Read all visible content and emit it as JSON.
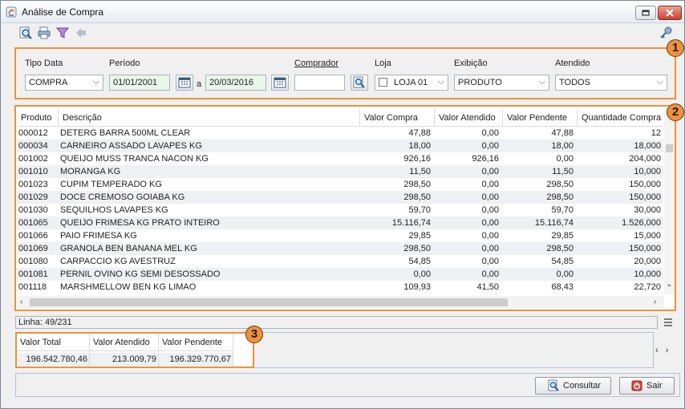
{
  "window": {
    "title": "Análise de Compra"
  },
  "filters": {
    "tipo_data": {
      "label": "Tipo Data",
      "value": "COMPRA"
    },
    "periodo": {
      "label": "Período",
      "start": "01/01/2001",
      "separator": "a",
      "end": "20/03/2016"
    },
    "comprador": {
      "label": "Comprador",
      "value": ""
    },
    "loja": {
      "label": "Loja",
      "value": "LOJA 01"
    },
    "exibicao": {
      "label": "Exibição",
      "value": "PRODUTO"
    },
    "atendido": {
      "label": "Atendido",
      "value": "TODOS"
    }
  },
  "badges": {
    "one": "1",
    "two": "2",
    "three": "3"
  },
  "table": {
    "headers": [
      "Produto",
      "Descrição",
      "Valor Compra",
      "Valor Atendido",
      "Valor Pendente",
      "Quantidade Compra"
    ],
    "rows": [
      [
        "000012",
        "DETERG BARRA 500ML CLEAR",
        "47,88",
        "0,00",
        "47,88",
        "12"
      ],
      [
        "000034",
        "CARNEIRO ASSADO LAVAPES KG",
        "18,00",
        "0,00",
        "18,00",
        "18,000"
      ],
      [
        "001002",
        "QUEIJO MUSS TRANCA NACON KG",
        "926,16",
        "926,16",
        "0,00",
        "204,000"
      ],
      [
        "001010",
        "MORANGA KG",
        "11,50",
        "0,00",
        "11,50",
        "10,000"
      ],
      [
        "001023",
        "CUPIM TEMPERADO KG",
        "298,50",
        "0,00",
        "298,50",
        "150,000"
      ],
      [
        "001029",
        "DOCE CREMOSO GOIABA KG",
        "298,50",
        "0,00",
        "298,50",
        "150,000"
      ],
      [
        "001030",
        "SEQUILHOS LAVAPES KG",
        "59,70",
        "0,00",
        "59,70",
        "30,000"
      ],
      [
        "001065",
        "QUEIJO FRIMESA KG PRATO INTEIRO",
        "15.116,74",
        "0,00",
        "15.116,74",
        "1.526,000"
      ],
      [
        "001066",
        "PAIO FRIMESA KG",
        "29,85",
        "0,00",
        "29,85",
        "15,000"
      ],
      [
        "001069",
        "GRANOLA BEN BANANA MEL KG",
        "298,50",
        "0,00",
        "298,50",
        "150,000"
      ],
      [
        "001080",
        "CARPACCIO KG AVESTRUZ",
        "54,85",
        "0,00",
        "54,85",
        "20,000"
      ],
      [
        "001081",
        "PERNIL OVINO KG SEMI DESOSSADO",
        "0,00",
        "0,00",
        "0,00",
        "10,000"
      ],
      [
        "001118",
        "MARSHMELLOW BEN KG LIMAO",
        "109,93",
        "41,50",
        "68,43",
        "22,720"
      ]
    ]
  },
  "status": {
    "line": "Linha: 49/231"
  },
  "totals": {
    "headers": [
      "Valor Total",
      "Valor Atendido",
      "Valor Pendente"
    ],
    "values": [
      "196.542.780,46",
      "213.009,79",
      "196.329.770,67"
    ]
  },
  "buttons": {
    "consultar": "Consultar",
    "sair": "Sair"
  },
  "colors": {
    "highlight": "#f0913a",
    "close": "#c9412d"
  }
}
